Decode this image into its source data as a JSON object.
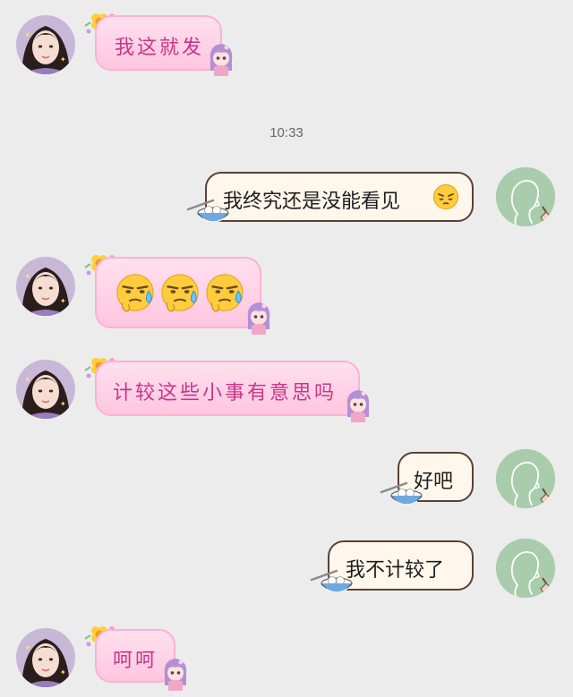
{
  "timestamp": "10:33",
  "messages": [
    {
      "sender": "other",
      "text": "我这就发"
    },
    {
      "sender": "me",
      "text": "我终究还是没能看见"
    },
    {
      "sender": "other",
      "type": "emoji",
      "emoji_count": 3,
      "emoji_icon": "sweating-smirk-emoji"
    },
    {
      "sender": "other",
      "text": "计较这些小事有意思吗"
    },
    {
      "sender": "me",
      "text": "好吧"
    },
    {
      "sender": "me",
      "text": "我不计较了"
    },
    {
      "sender": "other",
      "text": "呵呵"
    }
  ],
  "colors": {
    "background": "#ececec",
    "pink_bubble": "#ffc6df",
    "pink_text": "#c8358a",
    "cream_bubble": "#fff7ec",
    "cream_border": "#5b4034",
    "my_avatar": "#a8ccac"
  }
}
